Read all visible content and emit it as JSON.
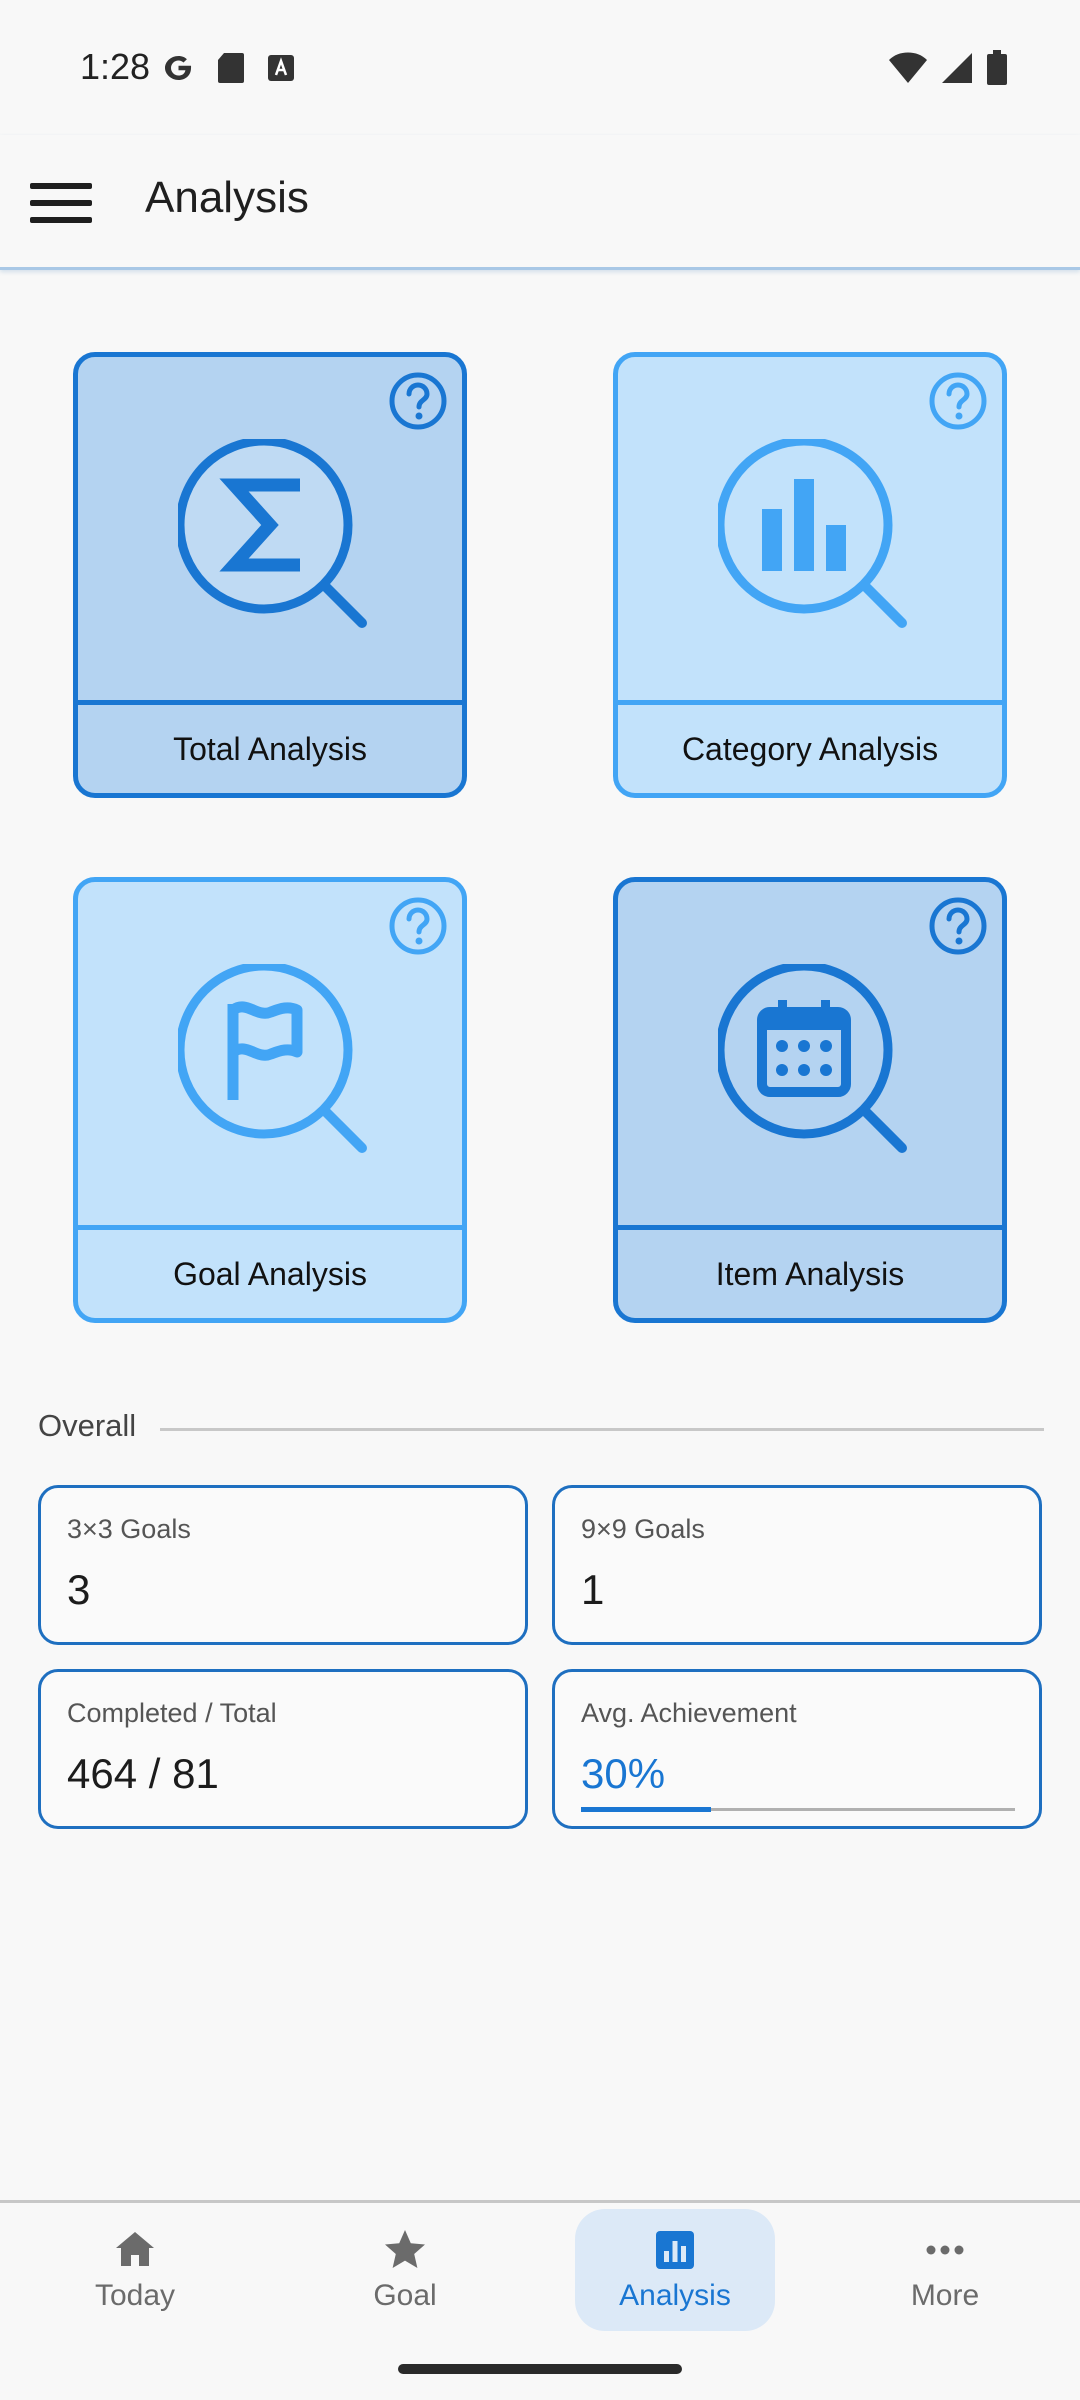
{
  "status_bar": {
    "time": "1:28"
  },
  "app_bar": {
    "title": "Analysis"
  },
  "cards": {
    "total": {
      "label": "Total Analysis"
    },
    "category": {
      "label": "Category Analysis"
    },
    "goal": {
      "label": "Goal Analysis"
    },
    "item": {
      "label": "Item Analysis"
    }
  },
  "overall": {
    "heading": "Overall",
    "goals_3x3": {
      "label": "3×3 Goals",
      "value": "3"
    },
    "goals_9x9": {
      "label": "9×9 Goals",
      "value": "1"
    },
    "completed_total": {
      "label": "Completed / Total",
      "value": "464 / 81"
    },
    "avg_achievement": {
      "label": "Avg. Achievement",
      "value": "30%",
      "progress": 0.3
    }
  },
  "bottom_nav": {
    "items": [
      {
        "label": "Today",
        "icon": "home-icon"
      },
      {
        "label": "Goal",
        "icon": "star-icon"
      },
      {
        "label": "Analysis",
        "icon": "analytics-icon",
        "active": true
      },
      {
        "label": "More",
        "icon": "more-horizontal-icon"
      }
    ]
  },
  "colors": {
    "accent": "#1976d2",
    "card_dark_bg": "#b4d3f1",
    "card_light_bg": "#c2e2fb",
    "card_light_border": "#42a5f5"
  }
}
